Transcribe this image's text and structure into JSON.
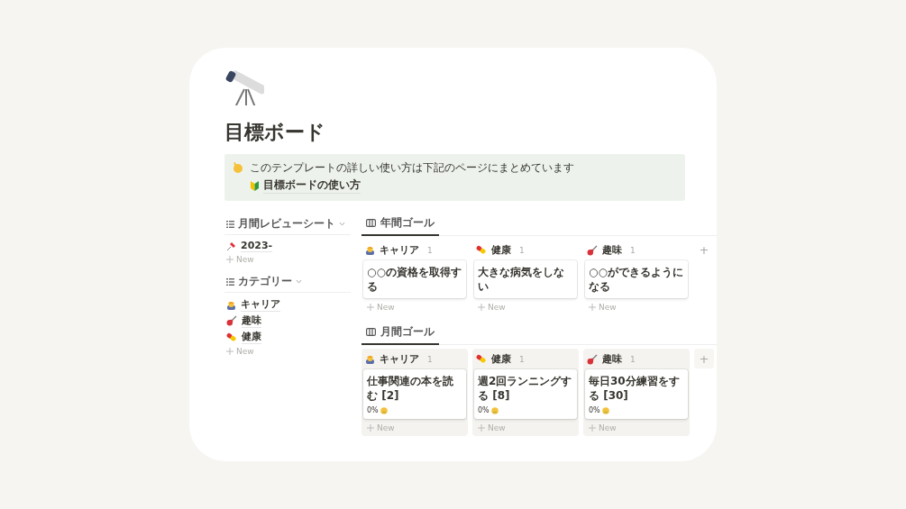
{
  "page": {
    "title": "目標ボード"
  },
  "callout": {
    "text": "このテンプレートの詳しい使い方は下記のページにまとめています",
    "link": "目標ボードの使い方"
  },
  "lists": [
    {
      "title": "月間レビューシート",
      "items": [
        {
          "label": "2023-",
          "kind": "pin"
        }
      ],
      "new_label": "New"
    },
    {
      "title": "カテゴリー",
      "items": [
        {
          "label": "キャリア",
          "kind": "career"
        },
        {
          "label": "趣味",
          "kind": "hobby"
        },
        {
          "label": "健康",
          "kind": "health"
        }
      ],
      "new_label": "New"
    }
  ],
  "boards": [
    {
      "tab": {
        "label": "年間ゴール",
        "selected": true
      },
      "shaded": false,
      "columns": [
        {
          "name": "キャリア",
          "kind": "career",
          "count": "1",
          "cards": [
            {
              "title": "○○の資格を取得する"
            }
          ],
          "new_label": "New"
        },
        {
          "name": "健康",
          "kind": "health",
          "count": "1",
          "cards": [
            {
              "title": "大きな病気をしない"
            }
          ],
          "new_label": "New"
        },
        {
          "name": "趣味",
          "kind": "hobby",
          "count": "1",
          "cards": [
            {
              "title": "○○ができるようになる"
            }
          ],
          "new_label": "New"
        }
      ],
      "add": "+"
    },
    {
      "tab": {
        "label": "月間ゴール",
        "selected": true
      },
      "shaded": true,
      "columns": [
        {
          "name": "キャリア",
          "kind": "career",
          "count": "1",
          "cards": [
            {
              "title": "仕事関連の本を読む [2]",
              "progress": "0%"
            }
          ],
          "new_label": "New"
        },
        {
          "name": "健康",
          "kind": "health",
          "count": "1",
          "cards": [
            {
              "title": "週2回ランニングする [8]",
              "progress": "0%"
            }
          ],
          "new_label": "New"
        },
        {
          "name": "趣味",
          "kind": "hobby",
          "count": "1",
          "cards": [
            {
              "title": "毎日30分練習をする [30]",
              "progress": "0%"
            }
          ],
          "new_label": "New"
        }
      ],
      "add": "+"
    }
  ]
}
